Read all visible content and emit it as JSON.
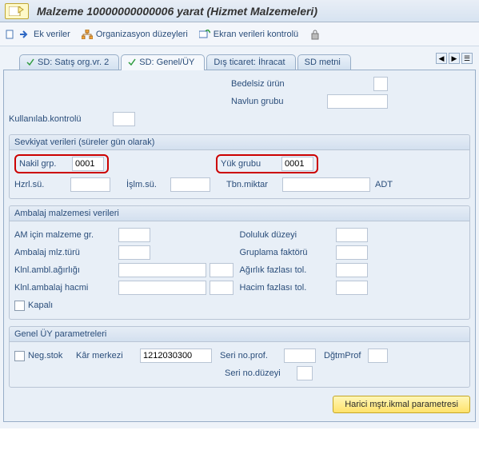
{
  "window": {
    "title": "Malzeme 10000000000006 yarat (Hizmet Malzemeleri)"
  },
  "toolbar": {
    "ek_veriler": "Ek veriler",
    "org_duzeyleri": "Organizasyon düzeyleri",
    "ekran_kontrolu": "Ekran verileri kontrolü"
  },
  "tabs": {
    "t0": "SD: Satış org.vr. 2",
    "t1": "SD: Genel/ÜY",
    "t2": "Dış ticaret: İhracat",
    "t3": "SD metni"
  },
  "top_fields": {
    "bedelsiz_urun": "Bedelsiz ürün",
    "navlun_grubu": "Navlun grubu",
    "kullanilab_kontrolu": "Kullanılab.kontrolü",
    "bedelsiz_val": "",
    "navlun_val": "",
    "kullanilab_val": ""
  },
  "sevkiyat": {
    "title": "Sevkiyat verileri (süreler gün olarak)",
    "nakil_grp_lbl": "Nakil grp.",
    "nakil_grp_val": "0001",
    "yuk_grubu_lbl": "Yük grubu",
    "yuk_grubu_val": "0001",
    "hzrl_su_lbl": "Hzrl.sü.",
    "hzrl_su_val": "",
    "islm_su_lbl": "İşlm.sü.",
    "islm_su_val": "",
    "tbn_miktar_lbl": "Tbn.miktar",
    "tbn_miktar_val": "",
    "tbn_unit": "ADT"
  },
  "ambalaj": {
    "title": "Ambalaj malzemesi verileri",
    "am_malzeme_gr_lbl": "AM için malzeme gr.",
    "am_malzeme_gr_val": "",
    "ambalaj_mlz_turu_lbl": "Ambalaj mlz.türü",
    "ambalaj_mlz_turu_val": "",
    "klnl_ambl_agir_lbl": "Klnl.ambl.ağırlığı",
    "klnl_ambl_agir_val": "",
    "klnl_ambl_agir_unit": "",
    "klnl_ambl_hacmi_lbl": "Klnl.ambalaj hacmi",
    "klnl_ambl_hacmi_val": "",
    "klnl_ambl_hacmi_unit": "",
    "kapali_lbl": "Kapalı",
    "doluluk_lbl": "Doluluk düzeyi",
    "doluluk_val": "",
    "gruplama_lbl": "Gruplama faktörü",
    "gruplama_val": "",
    "agirlik_fazla_lbl": "Ağırlık fazlası tol.",
    "agirlik_fazla_val": "",
    "hacim_fazla_lbl": "Hacim fazlası tol.",
    "hacim_fazla_val": ""
  },
  "genel_uy": {
    "title": "Genel ÜY parametreleri",
    "neg_stok_lbl": "Neg.stok",
    "kar_merkezi_lbl": "Kâr merkezi",
    "kar_merkezi_val": "1212030300",
    "seri_prof_lbl": "Seri no.prof.",
    "seri_prof_val": "",
    "dgtm_prof_lbl": "DğtmProf",
    "dgtm_prof_val": "",
    "seri_duzeyi_lbl": "Seri no.düzeyi",
    "seri_duzeyi_val": ""
  },
  "footer": {
    "harici_btn": "Harici mştr.ikmal parametresi"
  }
}
